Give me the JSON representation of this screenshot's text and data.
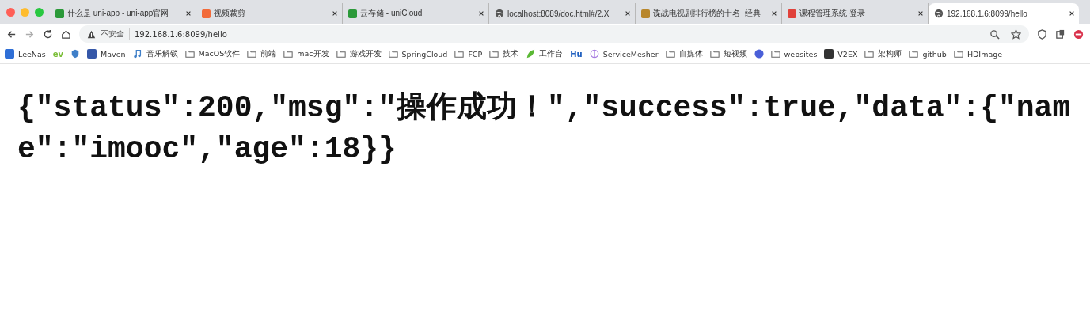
{
  "window": {
    "controls": [
      {
        "color": "#ff5f57"
      },
      {
        "color": "#febc2e"
      },
      {
        "color": "#28c840"
      }
    ]
  },
  "tabs": [
    {
      "title": "什么是 uni-app - uni-app官网",
      "selected": false,
      "color": "#2b9939"
    },
    {
      "title": "视频裁剪",
      "selected": false,
      "color": "#f26b3a"
    },
    {
      "title": "云存储 - uniCloud",
      "selected": false,
      "color": "#2b9939"
    },
    {
      "title": "localhost:8089/doc.html#/2.X",
      "selected": false,
      "color": "#555555"
    },
    {
      "title": "谍战电视剧排行榜的十名_经典",
      "selected": false,
      "color": "#b8862b"
    },
    {
      "title": "课程管理系统 登录",
      "selected": false,
      "color": "#e0413a"
    },
    {
      "title": "192.168.1.6:8099/hello",
      "selected": true,
      "color": "#555555"
    }
  ],
  "address_bar": {
    "security": "不安全",
    "url": "192.168.1.6:8099/hello"
  },
  "bookmarks": [
    {
      "kind": "site",
      "label": "LeeNas",
      "color": "#2f6fd6"
    },
    {
      "kind": "logo",
      "label": "ev",
      "color": "#7cbf3a"
    },
    {
      "kind": "shield",
      "color": "#3f7fc8"
    },
    {
      "kind": "site",
      "label": "Maven",
      "color": "#3557a8"
    },
    {
      "kind": "music",
      "label": "音乐解锁",
      "color": "#3f7fc8"
    },
    {
      "kind": "folder",
      "label": "MacOS软件"
    },
    {
      "kind": "folder",
      "label": "前端"
    },
    {
      "kind": "folder",
      "label": "mac开发"
    },
    {
      "kind": "folder",
      "label": "游戏开发"
    },
    {
      "kind": "folder",
      "label": "SpringCloud"
    },
    {
      "kind": "folder",
      "label": "FCP"
    },
    {
      "kind": "folder",
      "label": "技术"
    },
    {
      "kind": "leaf",
      "label": "工作台",
      "color": "#5ab834"
    },
    {
      "kind": "logo",
      "label": "Hu",
      "color": "#1f5fbf"
    },
    {
      "kind": "ring",
      "label": "ServiceMesher",
      "color": "#a77be0"
    },
    {
      "kind": "folder",
      "label": "自媒体"
    },
    {
      "kind": "folder",
      "label": "短视频"
    },
    {
      "kind": "circle",
      "color": "#4a5fd8"
    },
    {
      "kind": "folder",
      "label": "websites"
    },
    {
      "kind": "site",
      "label": "V2EX",
      "color": "#333333"
    },
    {
      "kind": "folder",
      "label": "架构师"
    },
    {
      "kind": "folder",
      "label": "github"
    },
    {
      "kind": "folder",
      "label": "HDImage"
    }
  ],
  "body": {
    "text": "{\"status\":200,\"msg\":\"操作成功！\",\"success\":true,\"data\":{\"name\":\"imooc\",\"age\":18}}"
  }
}
